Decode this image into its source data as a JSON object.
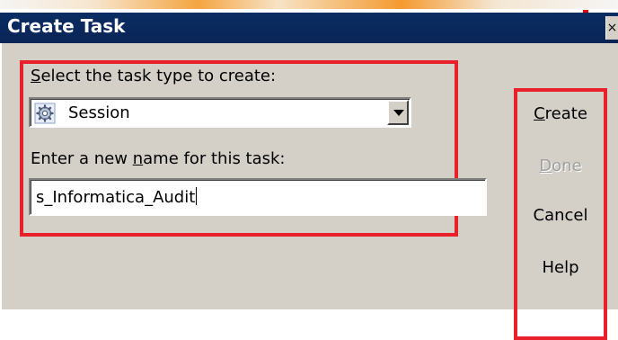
{
  "window": {
    "title": "Create Task",
    "close_glyph": "×"
  },
  "task_type": {
    "label": "Select the task type to create:",
    "selected": "Session",
    "icon": "session-gear-icon"
  },
  "task_name": {
    "label": "Enter a new name for this task:",
    "value": "s_Informatica_Audit"
  },
  "buttons": {
    "create": "Create",
    "done": "Done",
    "cancel": "Cancel",
    "help": "Help"
  },
  "colors": {
    "titlebar": "#0a2456",
    "dialog": "#d4d0c8",
    "highlight": "#e8202a"
  }
}
